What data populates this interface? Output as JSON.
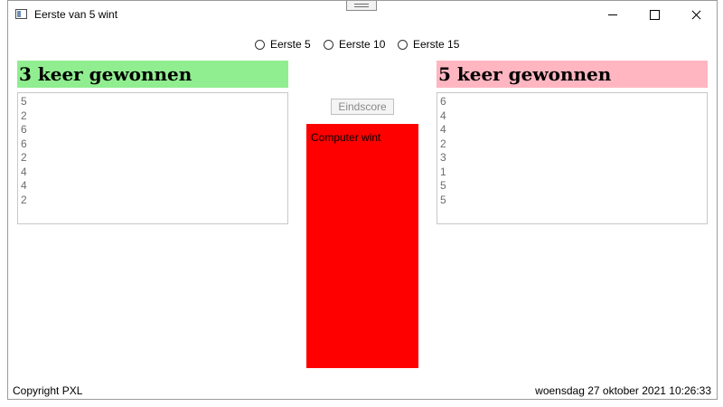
{
  "window": {
    "title": "Eerste van 5 wint"
  },
  "options": [
    {
      "label": "Eerste 5",
      "selected": false
    },
    {
      "label": "Eerste 10",
      "selected": false
    },
    {
      "label": "Eerste 15",
      "selected": false
    }
  ],
  "player": {
    "heading": "3 keer gewonnen",
    "color": "#90ee90",
    "rolls": [
      "5",
      "2",
      "6",
      "6",
      "2",
      "4",
      "4",
      "2"
    ]
  },
  "computer": {
    "heading": "5 keer gewonnen",
    "color": "#ffb6c1",
    "rolls": [
      "6",
      "4",
      "4",
      "2",
      "3",
      "1",
      "5",
      "5"
    ]
  },
  "center": {
    "button_label": "Eindscore",
    "result_text": "Computer wint",
    "result_color": "#ff0000"
  },
  "footer": {
    "copyright": "Copyright PXL",
    "datetime": "woensdag 27 oktober 2021 10:26:33"
  }
}
